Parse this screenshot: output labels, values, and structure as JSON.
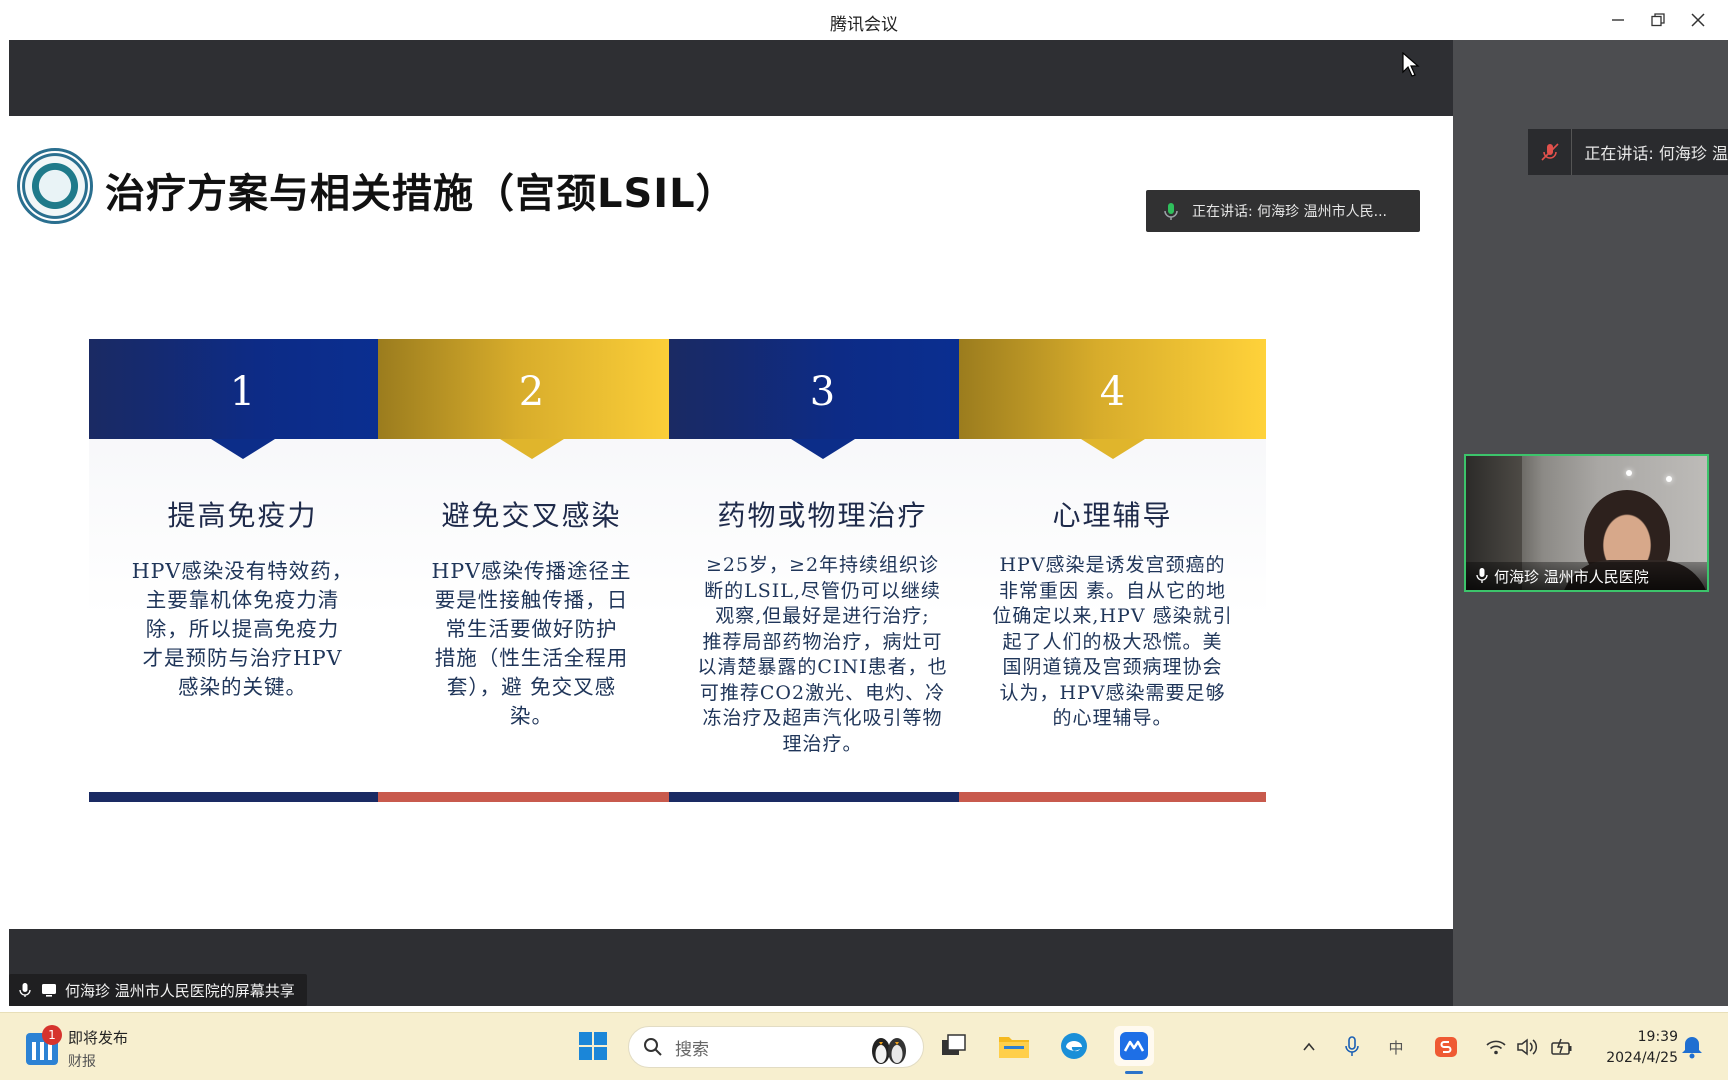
{
  "window": {
    "title": "腾讯会议"
  },
  "slide": {
    "title": "治疗方案与相关措施（宫颈LSIL）",
    "speaking_chip": "正在讲话:  何海珍 温州市人民...",
    "cards": [
      {
        "number": "1",
        "heading": "提高免疫力",
        "lines": [
          "HPV感染没有特效药，",
          "主要靠机体免疫力清",
          "除，所以提高免疫力",
          "才是预防与治疗HPV",
          "感染的关键。"
        ]
      },
      {
        "number": "2",
        "heading": "避免交叉感染",
        "lines": [
          "HPV感染传播途径主",
          "要是性接触传播，日",
          "常生活要做好防护",
          "措施（性生活全程用",
          "套），避  免交叉感",
          "染。"
        ]
      },
      {
        "number": "3",
        "heading": "药物或物理治疗",
        "lines": [
          "≥25岁，≥2年持续组织诊",
          "断的LSIL,尽管仍可以继续",
          "观察,但最好是进行治疗;",
          "推荐局部药物治疗，病灶可",
          "以清楚暴露的CINI患者，也",
          "可推荐CO2激光、电灼、冷",
          "冻治疗及超声汽化吸引等物",
          "理治疗。"
        ]
      },
      {
        "number": "4",
        "heading": "心理辅导",
        "lines": [
          "HPV感染是诱发宫颈癌的",
          "非常重因 素。自从它的地",
          "位确定以来,HPV 感染就引",
          "起了人们的极大恐慌。美",
          "国阴道镜及宫颈病理协会",
          "认为，HPV感染需要足够",
          "的心理辅导。"
        ]
      }
    ]
  },
  "share_label": "何海珍 温州市人民医院的屏幕共享",
  "right_panel": {
    "speaking_bar": "正在讲话:  何海珍 温",
    "participant_name": "何海珍 温州市人民医院"
  },
  "taskbar": {
    "news_title": "即将发布",
    "news_subtitle": "财报",
    "news_badge": "1",
    "search_placeholder": "搜索",
    "ime_label": "中",
    "time": "19:39",
    "date": "2024/4/25"
  },
  "colors": {
    "card_blue": "#0d2b86",
    "card_gold": "#ffd23a",
    "bar_navy": "#1a2a63",
    "bar_red": "#c85a4d",
    "speaker_border": "#3cc46b"
  }
}
